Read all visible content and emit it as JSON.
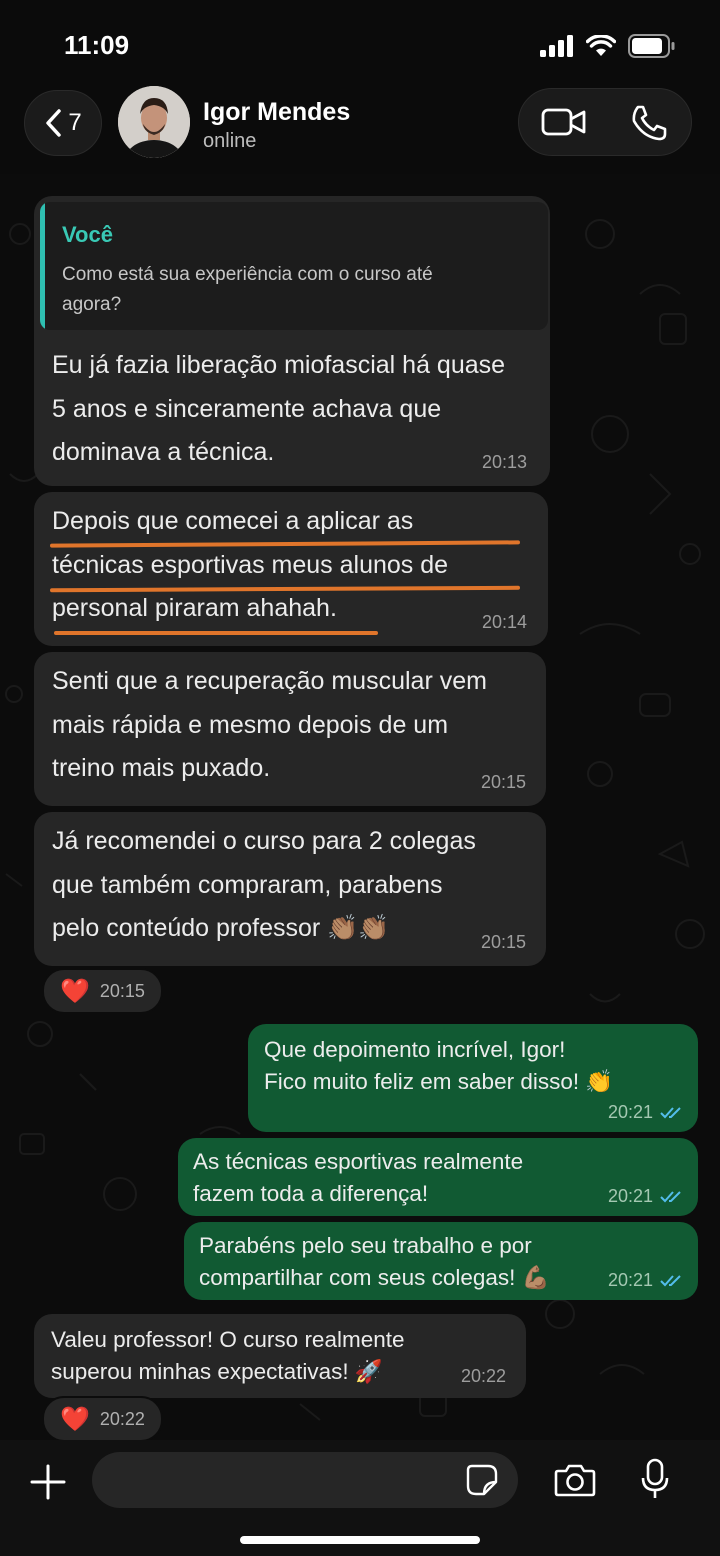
{
  "status_bar": {
    "time": "11:09"
  },
  "header": {
    "back_count": "7",
    "contact_name": "Igor Mendes",
    "contact_status": "online"
  },
  "messages": [
    {
      "direction": "in",
      "quote_author": "Você",
      "quote_text": "Como está sua experiência com o curso até\nagora?",
      "text": "Eu já fazia liberação miofascial há quase\n5 anos e sinceramente achava que\ndominava a técnica.",
      "time": "20:13"
    },
    {
      "direction": "in",
      "text": "Depois que comecei a aplicar as\ntécnicas esportivas meus alunos de\npersonal piraram ahahah.",
      "time": "20:14"
    },
    {
      "direction": "in",
      "text": "Senti que a recuperação muscular vem\nmais rápida e mesmo depois de um\ntreino mais puxado.",
      "time": "20:15"
    },
    {
      "direction": "in",
      "text": "Já recomendei o curso para 2 colegas\nque também compraram, parabens\npelo conteúdo professor 👏🏽👏🏽",
      "time": "20:15",
      "reaction": {
        "emoji": "❤️",
        "time": "20:15"
      }
    },
    {
      "direction": "out",
      "text": "Que depoimento incrível, Igor!\nFico muito feliz em saber disso! 👏",
      "time": "20:21"
    },
    {
      "direction": "out",
      "text": "As técnicas esportivas realmente\nfazem toda a diferença!",
      "time": "20:21"
    },
    {
      "direction": "out",
      "text": "Parabéns pelo seu trabalho e por\ncompartilhar com seus colegas! 💪🏽",
      "time": "20:21"
    },
    {
      "direction": "in",
      "text": "Valeu professor! O curso realmente\nsuperou minhas expectativas! 🚀",
      "time": "20:22",
      "reaction": {
        "emoji": "❤️",
        "time": "20:22"
      }
    }
  ],
  "composer": {
    "placeholder": ""
  },
  "colors": {
    "incoming_bubble": "#262626",
    "outgoing_bubble": "#115a33",
    "quote_accent": "#2fbfb1",
    "highlight_underline": "#e0752b",
    "read_ticks": "#53bdeb"
  },
  "icons": [
    "back-chevron-icon",
    "video-call-icon",
    "phone-icon",
    "plus-icon",
    "sticker-icon",
    "camera-icon",
    "microphone-icon",
    "signal-icon",
    "wifi-icon",
    "battery-icon",
    "read-ticks-icon",
    "heart-icon"
  ]
}
